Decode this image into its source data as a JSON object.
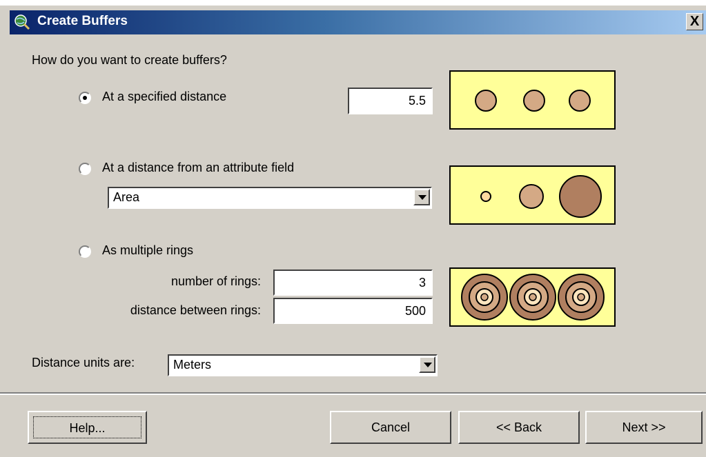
{
  "window": {
    "title": "Create Buffers",
    "close_glyph": "X"
  },
  "question": "How do you want to create buffers?",
  "options": {
    "specified": {
      "label": "At a specified distance",
      "checked": true,
      "value": "5.5"
    },
    "attribute": {
      "label": "At a distance from an attribute field",
      "checked": false,
      "field_value": "Area"
    },
    "rings": {
      "label": "As multiple rings",
      "checked": false,
      "count_label": "number of rings:",
      "count_value": "3",
      "distance_label": "distance between rings:",
      "distance_value": "500"
    }
  },
  "units": {
    "label": "Distance units are:",
    "value": "Meters"
  },
  "buttons": {
    "help": "Help...",
    "cancel": "Cancel",
    "back": "<< Back",
    "next": "Next >>"
  },
  "colors": {
    "preview_bg": "#ffff99",
    "buffer_fill": "#d4a985",
    "dark_fill": "#b07f60",
    "title_start": "#0a246a"
  },
  "icons": {
    "title": "globe-magnifier-icon"
  }
}
